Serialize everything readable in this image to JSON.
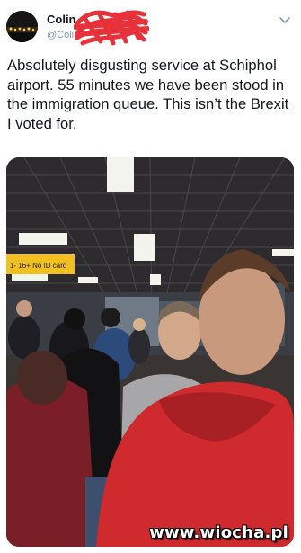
{
  "tweet": {
    "author": {
      "name": "Colin",
      "handle": "@Colin"
    },
    "text": "Absolutely disgusting service at Schiphol airport. 55 minutes we have been stood in the immigration queue. This isn’t the Brexit I voted for.",
    "photo": {
      "sign_text": "1-  16+  No ID card"
    }
  },
  "watermark": "www.wiocha.pl",
  "colors": {
    "redaction": "#e8323b",
    "text": "#14171a",
    "secondary": "#8899a6"
  },
  "icons": [
    "chevron-down-icon"
  ]
}
